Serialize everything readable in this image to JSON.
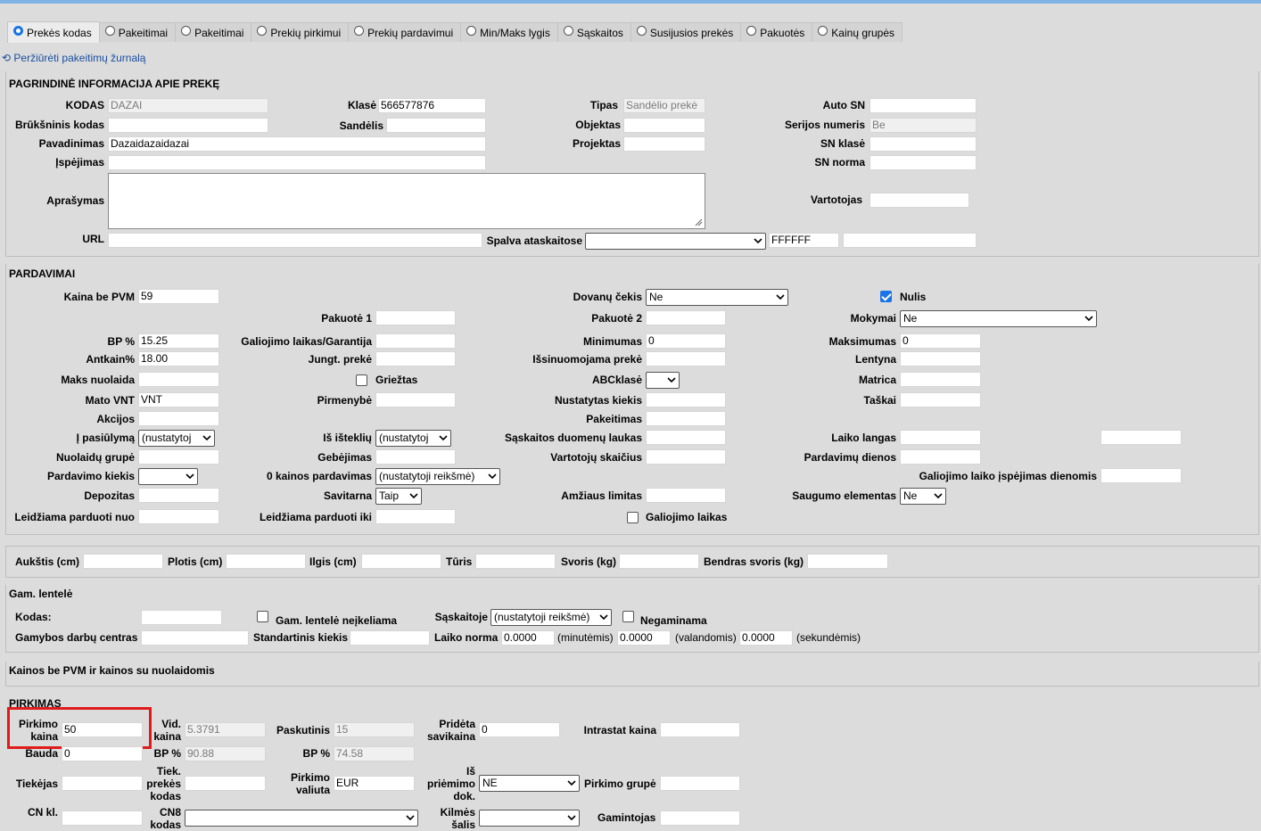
{
  "tabs": [
    "Prekės kodas",
    "Pakeitimai",
    "Pakeitimai",
    "Prekių pirkimui",
    "Prekių pardavimui",
    "Min/Maks lygis",
    "Sąskaitos",
    "Susijusios prekės",
    "Pakuotės",
    "Kainų grupės"
  ],
  "journal_link": "Peržiūrėti pakeitimų žurnalą",
  "main": {
    "title": "PAGRINDINĖ INFORMACIJA APIE PREKĘ",
    "kodas_label": "KODAS",
    "kodas": "DAZAI",
    "klase_label": "Klasė",
    "klase": "566577876",
    "tipas_label": "Tipas",
    "tipas": "Sandėlio prekė",
    "autosn_label": "Auto SN",
    "bruks_label": "Brūkšninis kodas",
    "sandelis_label": "Sandėlis",
    "objektas_label": "Objektas",
    "serijos_label": "Serijos numeris",
    "serijos": "Be",
    "pav_label": "Pavadinimas",
    "pav": "Dazaidazaidazai",
    "projektas_label": "Projektas",
    "snklase_label": "SN klasė",
    "ispejimas_label": "Įspėjimas",
    "snnorma_label": "SN norma",
    "aprasymas_label": "Aprašymas",
    "vartotojas_label": "Vartotojas",
    "url_label": "URL",
    "spalva_label": "Spalva ataskaitose",
    "spalva_hex": "FFFFFF"
  },
  "sales": {
    "title": "PARDAVIMAI",
    "kaina_label": "Kaina be PVM",
    "kaina": "59",
    "dovanu_label": "Dovanų čekis",
    "dovanu": "Ne",
    "nulis_label": "Nulis",
    "pak1_label": "Pakuotė 1",
    "pak2_label": "Pakuotė 2",
    "mokymai_label": "Mokymai",
    "mokymai": "Ne",
    "bp_label": "BP %",
    "bp": "15.25",
    "galiojimo_gar_label": "Galiojimo laikas/Garantija",
    "min_label": "Minimumas",
    "min": "0",
    "max_label": "Maksimumas",
    "max": "0",
    "antkain_label": "Antkain%",
    "antkain": "18.00",
    "jungt_label": "Jungt. prekė",
    "issinuom_label": "Išsinuomojama prekė",
    "lentyna_label": "Lentyna",
    "maksnuol_label": "Maks nuolaida",
    "grieztas_label": "Griežtas",
    "abc_label": "ABCklasė",
    "matrica_label": "Matrica",
    "matovnt_label": "Mato VNT",
    "matovnt": "VNT",
    "pirmenybe_label": "Pirmenybė",
    "nustkiekis_label": "Nustatytas kiekis",
    "taskai_label": "Taškai",
    "akcijos_label": "Akcijos",
    "pakeitimas_label": "Pakeitimas",
    "ipasiulyma_label": "Į pasiūlymą",
    "ipasiulyma": "(nustatytoj",
    "isistekliu_label": "Iš išteklių",
    "isistekliu": "(nustatytoj",
    "saskduom_label": "Sąskaitos duomenų laukas",
    "laikolangas_label": "Laiko langas",
    "nuolgrupe_label": "Nuolaidų grupė",
    "gebejimas_label": "Gebėjimas",
    "vartskaicius_label": "Vartotojų skaičius",
    "pardienos_label": "Pardavimų dienos",
    "pardkiekis_label": "Pardavimo kiekis",
    "nulkainos_label": "0 kainos pardavimas",
    "nulkainos": "(nustatytoji reikšmė)",
    "galisp_label": "Galiojimo laiko įspėjimas dienomis",
    "depozitas_label": "Depozitas",
    "savitarna_label": "Savitarna",
    "savitarna": "Taip",
    "amziaus_label": "Amžiaus limitas",
    "saugumo_label": "Saugumo elementas",
    "saugumo": "Ne",
    "leidnuo_label": "Leidžiama parduoti nuo",
    "leidiki_label": "Leidžiama parduoti iki",
    "galiojimas_label": "Galiojimo laikas"
  },
  "dims": {
    "aukstis": "Aukštis (cm)",
    "plotis": "Plotis (cm)",
    "ilgis": "Ilgis (cm)",
    "turis": "Tūris",
    "svoris": "Svoris (kg)",
    "bendras": "Bendras svoris (kg)"
  },
  "gam": {
    "title": "Gam. lentelė",
    "kodas_label": "Kodas:",
    "neikeliama_label": "Gam. lentelė neįkeliama",
    "saskaitoje_label": "Sąskaitoje",
    "saskaitoje": "(nustatytoji reikšmė)",
    "negaminama_label": "Negaminama",
    "centras_label": "Gamybos darbų centras",
    "stdkiekis_label": "Standartinis kiekis",
    "laikonorma_label": "Laiko norma",
    "min": "0.0000",
    "min_unit": "(minutėmis)",
    "val": "0.0000",
    "val_unit": "(valandomis)",
    "sek": "0.0000",
    "sek_unit": "(sekundėmis)"
  },
  "prices_title": "Kainos be PVM ir kainos su nuolaidomis",
  "purchase": {
    "title": "PIRKIMAS",
    "pirkkaina_label": "Pirkimo kaina",
    "pirkkaina": "50",
    "vid_label": "Vid. kaina",
    "vid": "5.3791",
    "paskutinis_label": "Paskutinis",
    "paskutinis": "15",
    "prideta_label": "Pridėta savikaina",
    "prideta": "0",
    "intrastat_label": "Intrastat kaina",
    "bauda_label": "Bauda",
    "bauda": "0",
    "bp1_label": "BP %",
    "bp1": "90.88",
    "bp2_label": "BP %",
    "bp2": "74.58",
    "tiekejas_label": "Tiekėjas",
    "tiekkodas_label": "Tiek. prekės kodas",
    "valiuta_label": "Pirkimo valiuta",
    "valiuta": "EUR",
    "ispriem_label": "Iš priėmimo dok.",
    "ispriem": "NE",
    "pirkgrupe_label": "Pirkimo grupė",
    "cn_label": "CN kl.",
    "cn8_label": "CN8 kodas",
    "kilmes_label": "Kilmės šalis",
    "gamintojas_label": "Gamintojas"
  }
}
